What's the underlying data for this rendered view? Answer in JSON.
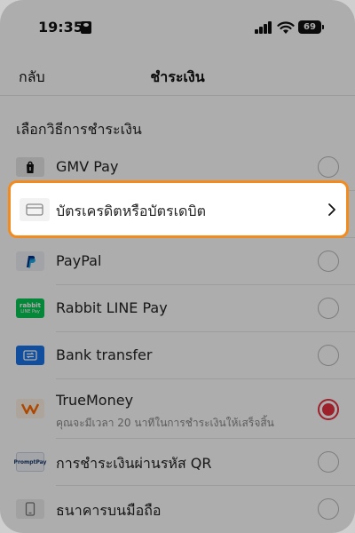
{
  "status_bar": {
    "time": "19:35",
    "battery": "69"
  },
  "nav": {
    "back_label": "กลับ",
    "title": "ชำระเงิน"
  },
  "section_title": "เลือกวิธีการชำระเงิน",
  "methods": [
    {
      "label": "GMV Pay",
      "logo": "gmv-pay-logo",
      "selected": false
    },
    {
      "label": "บัตรเครดิตหรือบัตรเดบิต",
      "logo": "card-icon",
      "selected": false
    },
    {
      "label": "PayPal",
      "logo": "paypal-logo",
      "selected": false
    },
    {
      "label": "Rabbit LINE Pay",
      "logo": "rabbit-line-pay-logo",
      "logo_text": "rabbit",
      "logo_subtext": "LINE Pay",
      "selected": false
    },
    {
      "label": "Bank transfer",
      "logo": "bank-transfer-icon",
      "selected": false
    },
    {
      "label": "TrueMoney",
      "sublabel": "คุณจะมีเวลา 20 นาทีในการชำระเงินให้เสร็จสิ้น",
      "logo": "truemoney-logo",
      "selected": true
    },
    {
      "label": "การชำระเงินผ่านรหัส QR",
      "logo": "promptpay-logo",
      "logo_text": "PromptPay",
      "selected": false
    },
    {
      "label": "ธนาคารบนมือถือ",
      "logo": "mobile-banking-icon",
      "selected": false
    }
  ],
  "colors": {
    "highlight": "#f28a1e",
    "selected": "#e8313f",
    "overlay": "rgba(0,0,0,0.32)"
  }
}
